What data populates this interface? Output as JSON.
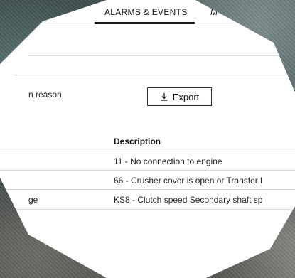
{
  "tabs": {
    "active": "ALARMS & EVENTS",
    "next_partial": "M"
  },
  "filters": {
    "reason_label_partial": "n reason"
  },
  "toolbar": {
    "export_label": "Export",
    "export_icon": "download-icon"
  },
  "table": {
    "header_description": "Description",
    "rows": [
      {
        "left_partial": "",
        "description": "11 - No connection to engine"
      },
      {
        "left_partial": "",
        "description": "66 - Crusher cover is open or Transfer l"
      },
      {
        "left_partial": "ge",
        "description": "KS8 - Clutch speed Secondary shaft sp"
      }
    ]
  },
  "colors": {
    "tab_underline": "#1a1a1a",
    "divider": "#d6d6d6",
    "text": "#111111"
  }
}
